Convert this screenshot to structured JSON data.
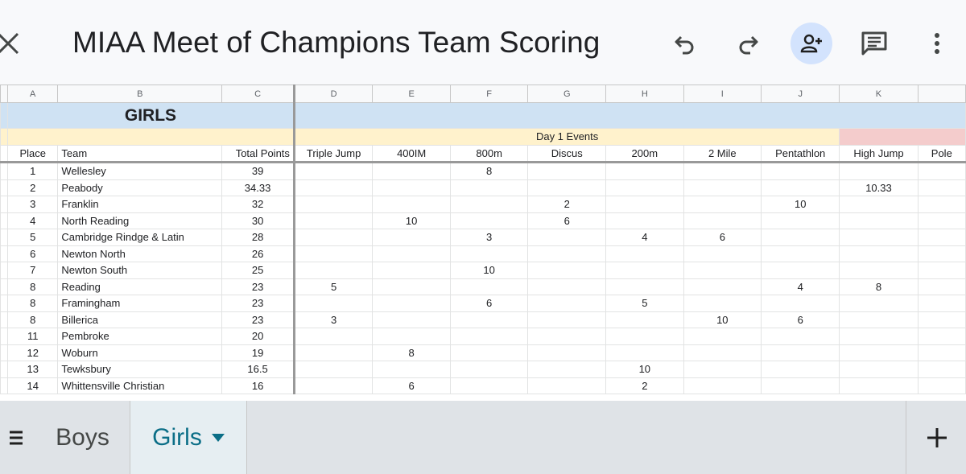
{
  "app": {
    "title": "MIAA Meet of Champions Team Scoring"
  },
  "toolbar": {
    "icons": [
      "close-icon",
      "undo-icon",
      "redo-icon",
      "add-person-icon",
      "comment-icon",
      "more-vert-icon"
    ],
    "accent": "#d3e3fd"
  },
  "sheet": {
    "column_letters": [
      "A",
      "B",
      "C",
      "D",
      "E",
      "F",
      "G",
      "H",
      "I",
      "J",
      "K"
    ],
    "title_label": "GIRLS",
    "day1_label": "Day 1 Events",
    "headers": [
      "Place",
      "Team",
      "Total Points",
      "Triple Jump",
      "400IM",
      "800m",
      "Discus",
      "200m",
      "2 Mile",
      "Pentathlon",
      "High Jump",
      "Pole"
    ],
    "rows": [
      {
        "place": "1",
        "team": "Wellesley",
        "total": "39",
        "cells": [
          "",
          "",
          "8",
          "",
          "",
          "",
          "",
          "",
          ""
        ]
      },
      {
        "place": "2",
        "team": "Peabody",
        "total": "34.33",
        "cells": [
          "",
          "",
          "",
          "",
          "",
          "",
          "",
          "10.33",
          ""
        ]
      },
      {
        "place": "3",
        "team": "Franklin",
        "total": "32",
        "cells": [
          "",
          "",
          "",
          "2",
          "",
          "",
          "10",
          "",
          ""
        ]
      },
      {
        "place": "4",
        "team": "North Reading",
        "total": "30",
        "cells": [
          "",
          "10",
          "",
          "6",
          "",
          "",
          "",
          "",
          ""
        ]
      },
      {
        "place": "5",
        "team": "Cambridge Rindge & Latin",
        "total": "28",
        "cells": [
          "",
          "",
          "3",
          "",
          "4",
          "6",
          "",
          "",
          ""
        ]
      },
      {
        "place": "6",
        "team": "Newton North",
        "total": "26",
        "cells": [
          "",
          "",
          "",
          "",
          "",
          "",
          "",
          "",
          ""
        ]
      },
      {
        "place": "7",
        "team": "Newton South",
        "total": "25",
        "cells": [
          "",
          "",
          "10",
          "",
          "",
          "",
          "",
          "",
          ""
        ]
      },
      {
        "place": "8",
        "team": "Reading",
        "total": "23",
        "cells": [
          "5",
          "",
          "",
          "",
          "",
          "",
          "4",
          "8",
          ""
        ]
      },
      {
        "place": "8",
        "team": "Framingham",
        "total": "23",
        "cells": [
          "",
          "",
          "6",
          "",
          "5",
          "",
          "",
          "",
          ""
        ]
      },
      {
        "place": "8",
        "team": "Billerica",
        "total": "23",
        "cells": [
          "3",
          "",
          "",
          "",
          "",
          "10",
          "6",
          "",
          ""
        ]
      },
      {
        "place": "11",
        "team": "Pembroke",
        "total": "20",
        "cells": [
          "",
          "",
          "",
          "",
          "",
          "",
          "",
          "",
          ""
        ]
      },
      {
        "place": "12",
        "team": "Woburn",
        "total": "19",
        "cells": [
          "",
          "8",
          "",
          "",
          "",
          "",
          "",
          "",
          ""
        ]
      },
      {
        "place": "13",
        "team": "Tewksbury",
        "total": "16.5",
        "cells": [
          "",
          "",
          "",
          "",
          "10",
          "",
          "",
          "",
          ""
        ]
      },
      {
        "place": "14",
        "team": "Whittensville Christian",
        "total": "16",
        "cells": [
          "",
          "6",
          "",
          "",
          "2",
          "",
          "",
          "",
          ""
        ]
      }
    ]
  },
  "tabs": {
    "menu_icon": "list-icon",
    "items": [
      {
        "label": "Boys",
        "active": false
      },
      {
        "label": "Girls",
        "active": true
      }
    ],
    "add_icon": "plus-icon"
  }
}
